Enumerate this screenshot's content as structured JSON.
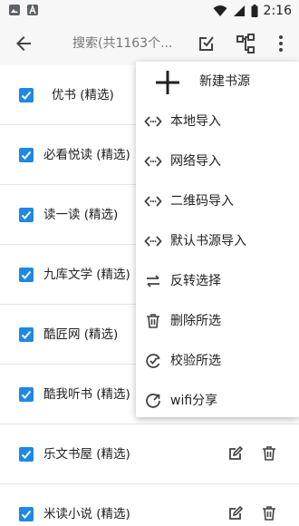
{
  "status_bar": {
    "time": "2:16",
    "notification_icons": [
      "photo-icon",
      "text-icon"
    ]
  },
  "toolbar": {
    "search_placeholder": "搜索(共1163个..."
  },
  "list": {
    "items": [
      {
        "label": "优书 (精选)",
        "checked": true
      },
      {
        "label": "必看悦读 (精选)",
        "checked": true
      },
      {
        "label": "读一读 (精选)",
        "checked": true
      },
      {
        "label": "九库文学 (精选)",
        "checked": true
      },
      {
        "label": "酷匠网 (精选)",
        "checked": true
      },
      {
        "label": "酷我听书 (精选)",
        "checked": true
      },
      {
        "label": "乐文书屋 (精选)",
        "checked": true
      },
      {
        "label": "米读小说 (精选)",
        "checked": true
      }
    ]
  },
  "menu": {
    "items": [
      {
        "label": "新建书源",
        "icon": "plus-icon"
      },
      {
        "label": "本地导入",
        "icon": "code-icon"
      },
      {
        "label": "网络导入",
        "icon": "code-icon"
      },
      {
        "label": "二维码导入",
        "icon": "code-icon"
      },
      {
        "label": "默认书源导入",
        "icon": "code-icon"
      },
      {
        "label": "反转选择",
        "icon": "swap-icon"
      },
      {
        "label": "删除所选",
        "icon": "trash-icon"
      },
      {
        "label": "校验所选",
        "icon": "verify-icon"
      },
      {
        "label": "wifi分享",
        "icon": "refresh-icon"
      }
    ]
  },
  "colors": {
    "accent": "#1e88e5",
    "toolbar_bg": "#f7f7f7",
    "icon_gray": "#424242"
  }
}
